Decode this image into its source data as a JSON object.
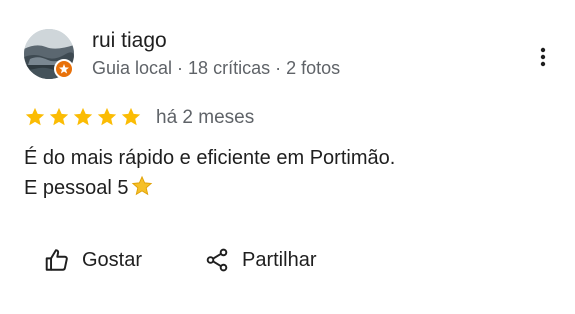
{
  "reviewer": {
    "name": "rui tiago",
    "role": "Guia local",
    "separator_1": " · ",
    "reviews_count": "18 críticas",
    "separator_2": " · ",
    "photos_count": "2 fotos",
    "avatar_icon": "profile-photo",
    "badge_icon": "local-guide-badge",
    "badge_color": "#e8710a"
  },
  "menu": {
    "icon": "more-vert-icon"
  },
  "rating": {
    "stars": 5,
    "max": 5,
    "star_color": "#fbbc04"
  },
  "date": "há 2 meses",
  "review": {
    "line_1": "É do mais rápido e eficiente em Portimão.",
    "line_2": "E pessoal 5",
    "emoji": "star-emoji"
  },
  "actions": {
    "like_label": "Gostar",
    "like_icon": "thumbs-up-icon",
    "share_label": "Partilhar",
    "share_icon": "share-icon"
  }
}
